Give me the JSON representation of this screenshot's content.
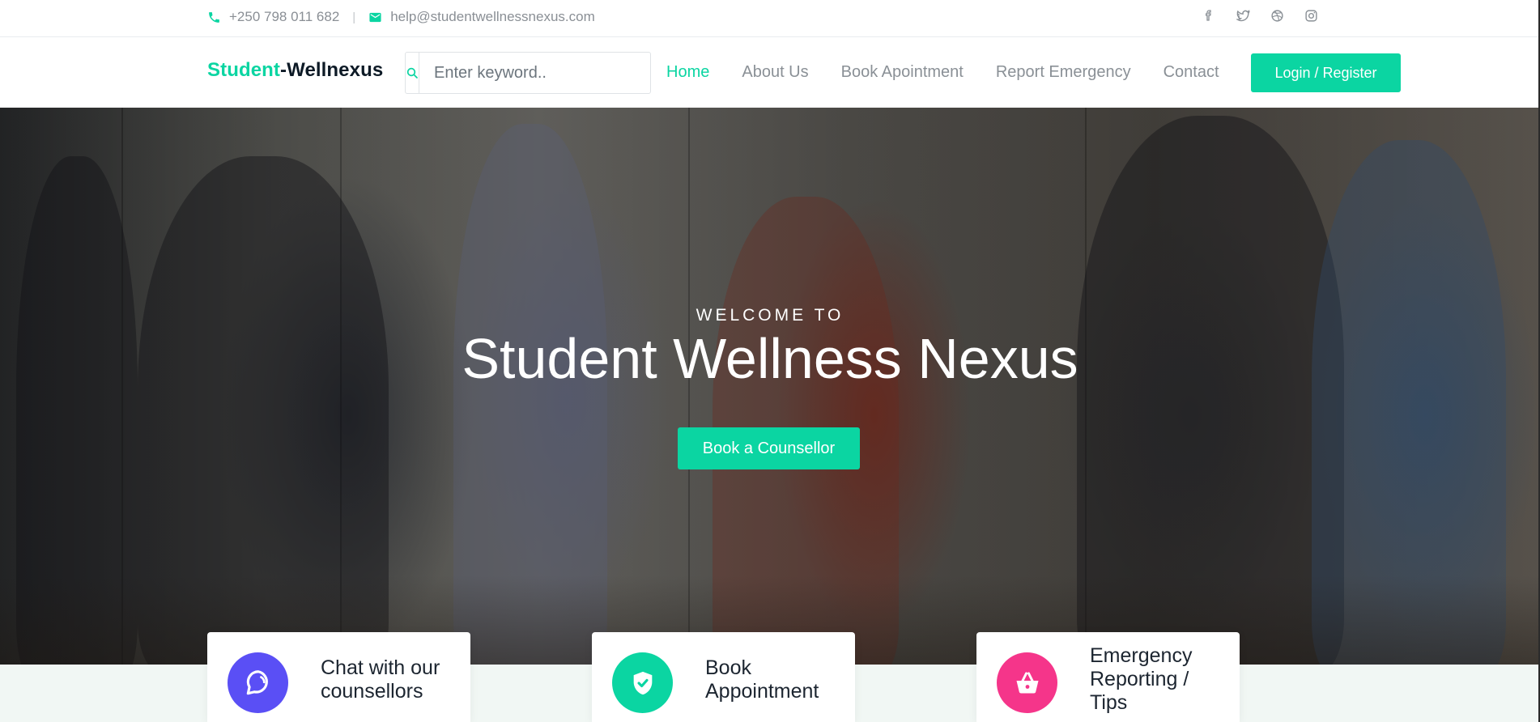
{
  "topbar": {
    "phone": "+250 798 011 682",
    "separator": "|",
    "email": "help@studentwellnessnexus.com",
    "social_icons": [
      "facebook-icon",
      "twitter-icon",
      "dribbble-icon",
      "instagram-icon"
    ]
  },
  "nav": {
    "brand_accent": "Student",
    "brand_rest": "-Wellnexus",
    "search_placeholder": "Enter keyword..",
    "links": [
      "Home",
      "About Us",
      "Book Apointment",
      "Report Emergency",
      "Contact"
    ],
    "active": "Home",
    "login_label": "Login / Register"
  },
  "hero": {
    "welcome": "WELCOME TO",
    "title": "Student Wellness Nexus",
    "cta_label": "Book a Counsellor"
  },
  "features": [
    {
      "line1": "Chat with our",
      "line2": "counsellors",
      "line3": "",
      "icon": "chat-icon",
      "color": "#5a4ff5"
    },
    {
      "line1": "Book",
      "line2": "Appointment",
      "line3": "",
      "icon": "shield-check-icon",
      "color": "#0bd5a2"
    },
    {
      "line1": "Emergency",
      "line2": "Reporting /",
      "line3": "Tips",
      "icon": "basket-icon",
      "color": "#f5358a"
    }
  ],
  "colors": {
    "accent": "#0bd5a2",
    "text_muted": "#8a9096",
    "band_bg": "#f1f7f4"
  }
}
